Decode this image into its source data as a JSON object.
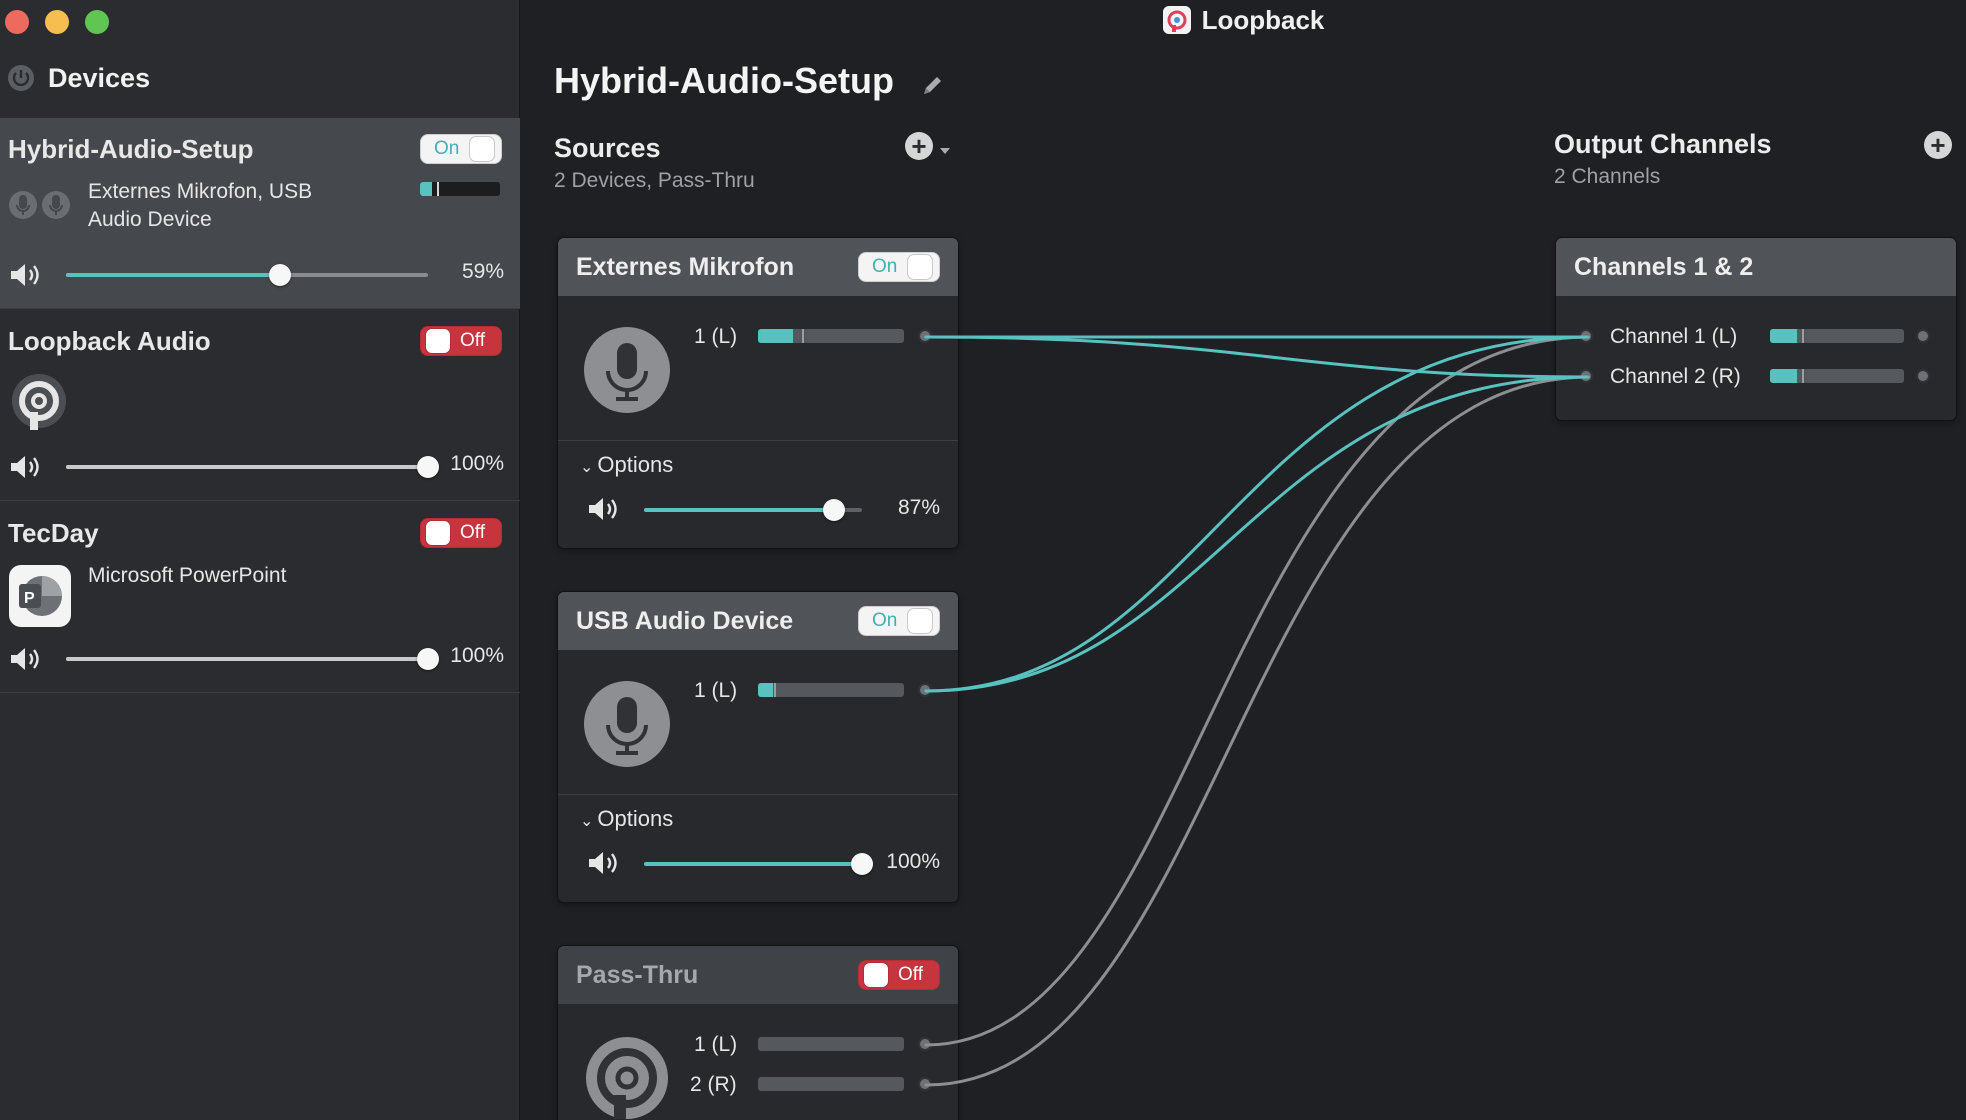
{
  "window": {
    "app_title": "Loopback",
    "traffic_lights": [
      "close",
      "minimize",
      "zoom"
    ]
  },
  "sidebar": {
    "heading": "Devices",
    "devices": [
      {
        "name": "Hybrid-Audio-Setup",
        "toggle": "On",
        "state": "on",
        "subtitle_line1": "Externes Mikrofon, USB",
        "subtitle_line2": "Audio Device",
        "volume_pct_text": "59%",
        "volume": 0.59,
        "level": 0.15,
        "selected": true
      },
      {
        "name": "Loopback Audio",
        "toggle": "Off",
        "state": "off",
        "volume_pct_text": "100%",
        "volume": 1.0
      },
      {
        "name": "TecDay",
        "toggle": "Off",
        "state": "off",
        "subtitle_line1": "Microsoft PowerPoint",
        "volume_pct_text": "100%",
        "volume": 1.0
      }
    ]
  },
  "main": {
    "setup_title": "Hybrid-Audio-Setup",
    "sources": {
      "title": "Sources",
      "subtitle": "2 Devices, Pass-Thru",
      "cards": [
        {
          "title": "Externes Mikrofon",
          "toggle": "On",
          "channel": "1 (L)",
          "level": 0.24,
          "options_label": "Options",
          "volume_pct_text": "87%",
          "volume": 0.87
        },
        {
          "title": "USB Audio Device",
          "toggle": "On",
          "channel": "1 (L)",
          "level": 0.1,
          "options_label": "Options",
          "volume_pct_text": "100%",
          "volume": 1.0
        },
        {
          "title": "Pass-Thru",
          "toggle": "Off",
          "channels": [
            "1 (L)",
            "2 (R)"
          ]
        }
      ]
    },
    "outputs": {
      "title": "Output Channels",
      "subtitle": "2 Channels",
      "card": {
        "title": "Channels 1 & 2",
        "channels": [
          {
            "label": "Channel 1 (L)",
            "level": 0.2
          },
          {
            "label": "Channel 2 (R)",
            "level": 0.2
          }
        ]
      }
    },
    "colors": {
      "accent": "#59c2c1",
      "off_red": "#c6343e",
      "wire_gray": "#8c8f92"
    }
  }
}
